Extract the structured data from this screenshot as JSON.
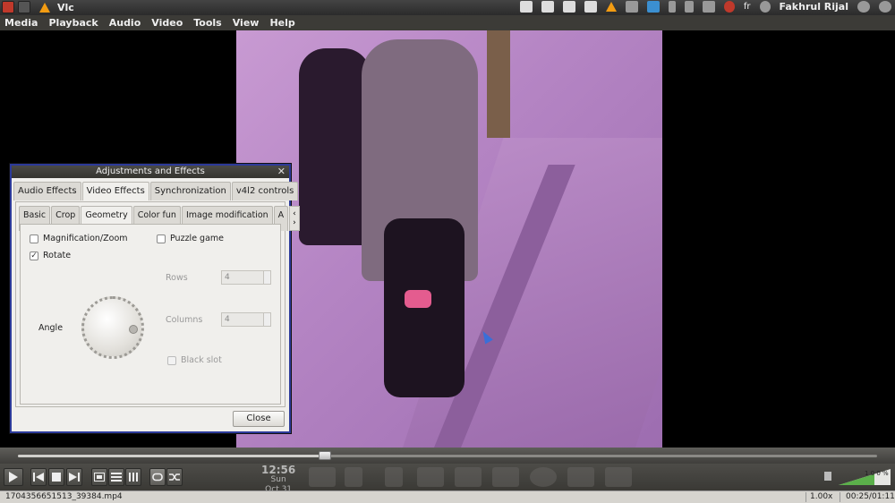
{
  "top_panel": {
    "app_title": "Vlc",
    "keyboard_layout": "fr",
    "user_name": "Fakhrul Rijal"
  },
  "menu": [
    "Media",
    "Playback",
    "Audio",
    "Video",
    "Tools",
    "View",
    "Help"
  ],
  "dialog": {
    "title": "Adjustments and Effects",
    "close_glyph": "✕",
    "tabs": [
      "Audio Effects",
      "Video Effects",
      "Synchronization",
      "v4l2 controls"
    ],
    "active_tab": "Video Effects",
    "subtabs": [
      "Basic",
      "Crop",
      "Geometry",
      "Color fun",
      "Image modification",
      "A"
    ],
    "active_subtab": "Geometry",
    "scroll_glyph": "‹ ›",
    "magnification_label": "Magnification/Zoom",
    "magnification_checked": false,
    "rotate_label": "Rotate",
    "rotate_checked": true,
    "check_glyph": "✓",
    "angle_label": "Angle",
    "puzzle_label": "Puzzle game",
    "puzzle_checked": false,
    "rows_label": "Rows",
    "rows_value": "4",
    "columns_label": "Columns",
    "columns_value": "4",
    "black_slot_label": "Black slot",
    "close_button": "Close"
  },
  "seek": {
    "progress": 0.357
  },
  "clock": {
    "time": "12:56",
    "day": "Sun",
    "date": "Oct 31"
  },
  "status": {
    "filename": "1704356651513_39384.mp4",
    "rate": "1.00x",
    "time": "00:25/01:11"
  },
  "volume": {
    "label": "1 0 0 %"
  },
  "icons": {
    "play": "play-icon",
    "prev": "previous-icon",
    "stop": "stop-icon",
    "next": "next-icon",
    "fullscreen": "fullscreen-icon",
    "playlist": "playlist-icon",
    "extended": "extended-settings-icon",
    "loop": "loop-icon",
    "shuffle": "shuffle-icon"
  },
  "colors": {
    "dialog_border": "#2c3a9a",
    "video_tint": "#c89ad2"
  }
}
